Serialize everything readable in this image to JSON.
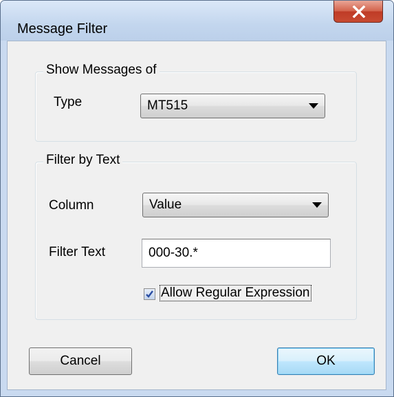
{
  "window": {
    "title": "Message Filter",
    "close_icon": "close-x-icon"
  },
  "show_messages": {
    "legend": "Show Messages of",
    "type_label": "Type",
    "type_value": "MT515"
  },
  "filter_by_text": {
    "legend": "Filter by Text",
    "column_label": "Column",
    "column_value": "Value",
    "filter_text_label": "Filter Text",
    "filter_text_value": "000-30.*",
    "regex_checkbox_checked": true,
    "regex_checkbox_label": "Allow Regular Expression"
  },
  "buttons": {
    "cancel_label": "Cancel",
    "ok_label": "OK"
  },
  "colors": {
    "close_button": "#c84a32",
    "checkmark": "#2a4ea3",
    "default_button_border": "#3c7fb1"
  }
}
